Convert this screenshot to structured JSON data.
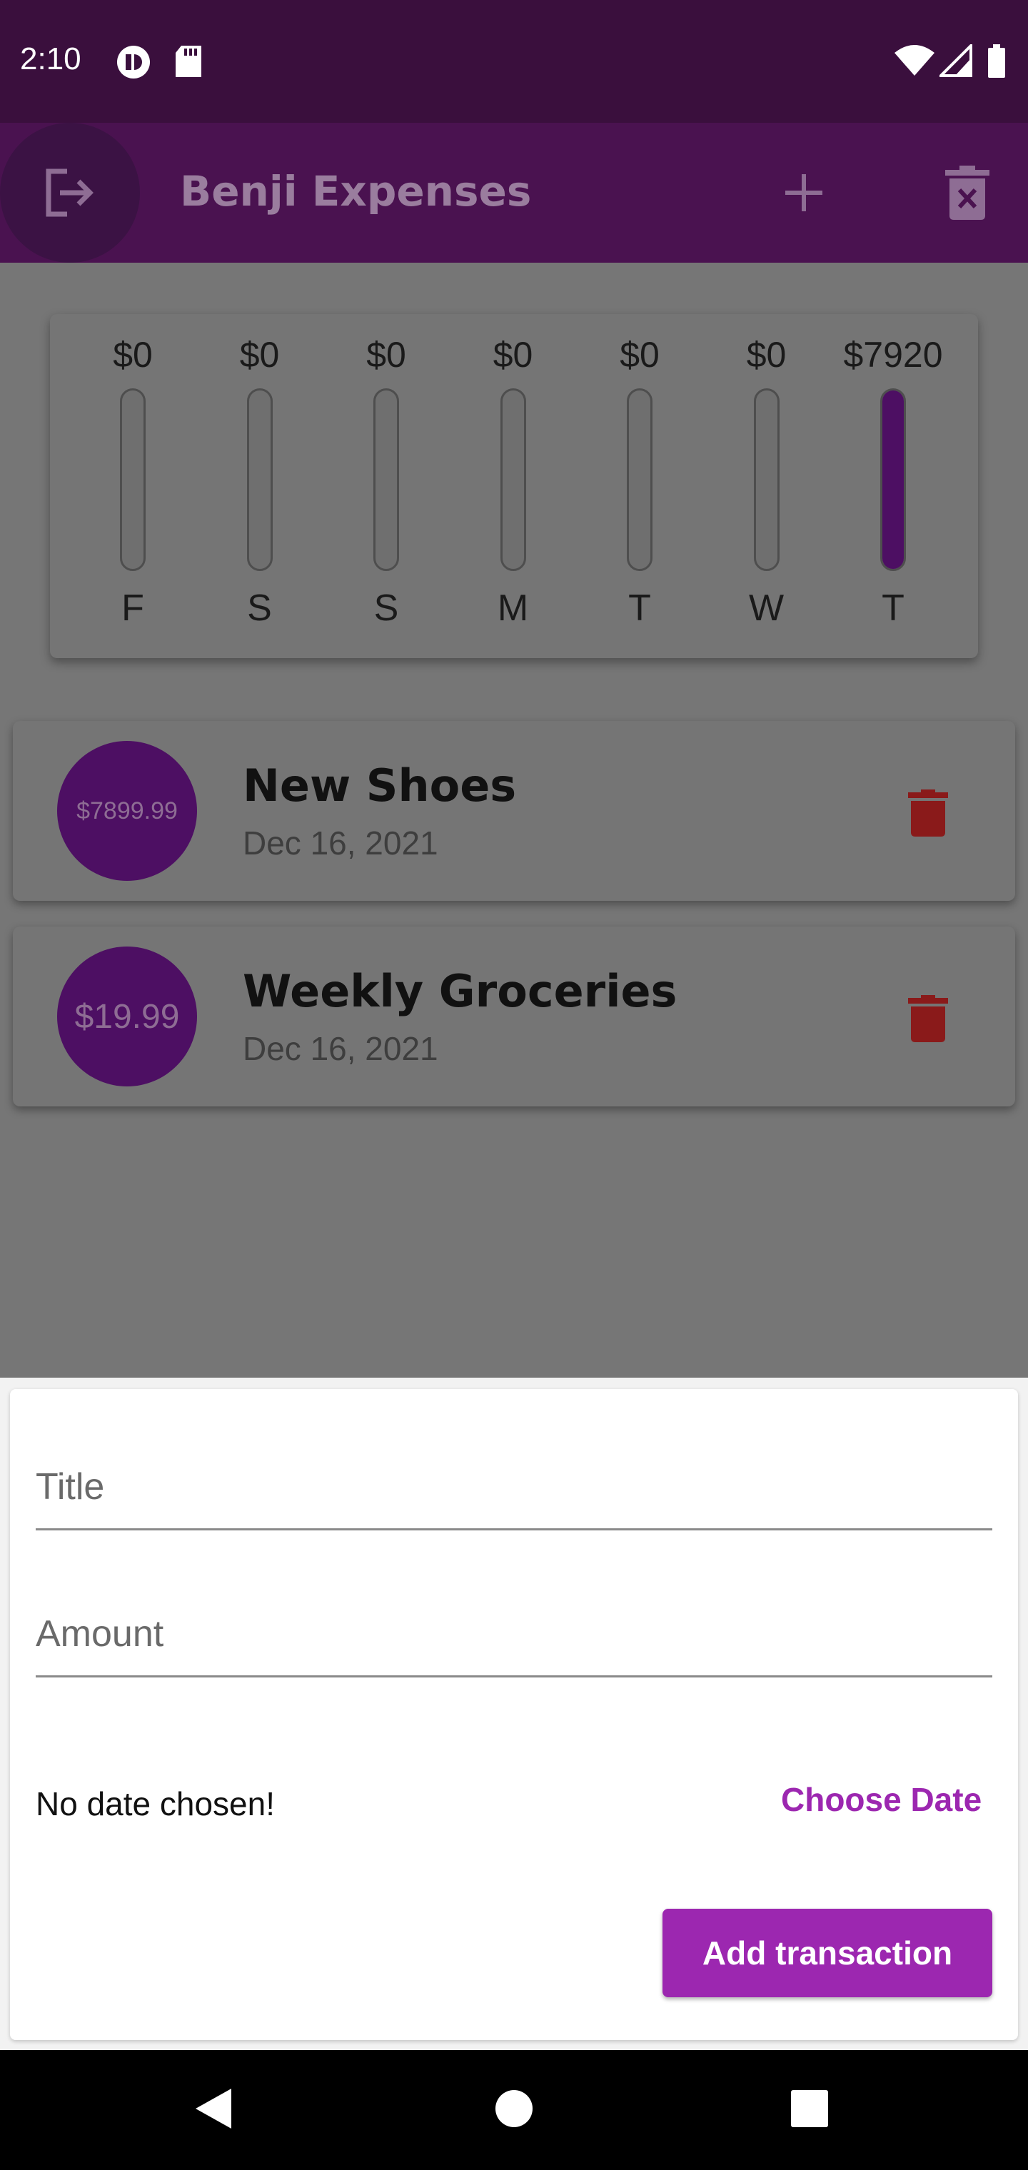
{
  "status_bar": {
    "time": "2:10",
    "icons": [
      "notification-app-icon",
      "sd-card-icon",
      "wifi-icon",
      "signal-icon",
      "battery-icon"
    ]
  },
  "app_bar": {
    "title": "Benji Expenses",
    "icons": [
      "logout-icon",
      "add-icon",
      "delete-all-icon"
    ],
    "background_color": "#4a1250"
  },
  "chart": {
    "days": [
      {
        "label": "F",
        "amount": "$0",
        "fraction": 0
      },
      {
        "label": "S",
        "amount": "$0",
        "fraction": 0
      },
      {
        "label": "S",
        "amount": "$0",
        "fraction": 0
      },
      {
        "label": "M",
        "amount": "$0",
        "fraction": 0
      },
      {
        "label": "T",
        "amount": "$0",
        "fraction": 0
      },
      {
        "label": "W",
        "amount": "$0",
        "fraction": 0
      },
      {
        "label": "T",
        "amount": "$7920",
        "fraction": 1
      }
    ],
    "fill_color": "#4d0f63"
  },
  "transactions": [
    {
      "amount": "$7899.99",
      "title": "New Shoes",
      "date": "Dec 16, 2021"
    },
    {
      "amount": "$19.99",
      "title": "Weekly Groceries",
      "date": "Dec 16, 2021"
    }
  ],
  "form": {
    "title_placeholder": "Title",
    "amount_placeholder": "Amount",
    "no_date_text": "No date chosen!",
    "choose_date_label": "Choose Date",
    "submit_label": "Add transaction",
    "accent_color": "#9c27b0"
  },
  "nav_bar": {
    "buttons": [
      "back-icon",
      "home-icon",
      "recents-icon"
    ]
  }
}
